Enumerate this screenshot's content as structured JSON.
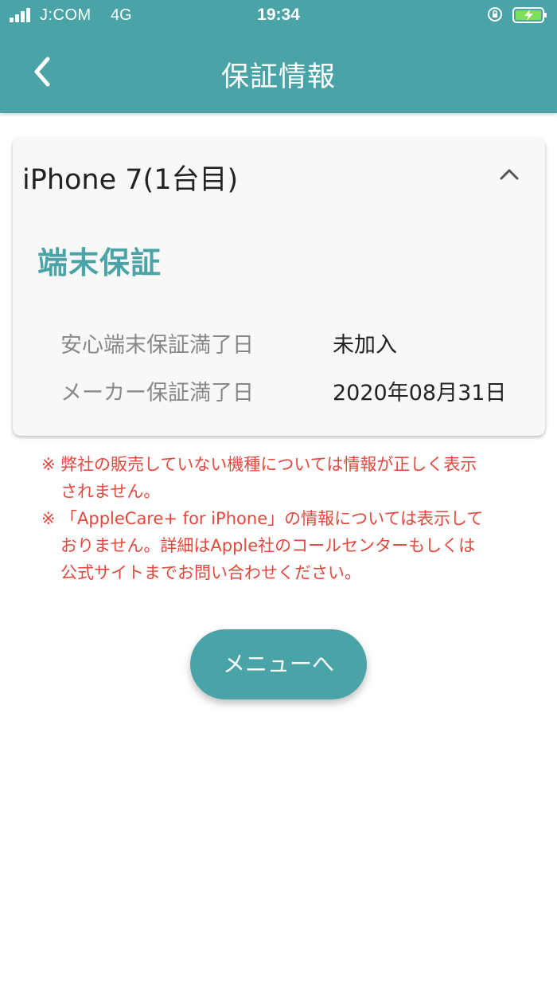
{
  "status_bar": {
    "carrier": "J:COM",
    "network": "4G",
    "time": "19:34"
  },
  "nav": {
    "title": "保証情報"
  },
  "card": {
    "device_name": "iPhone 7(1台目)",
    "section_title": "端末保証",
    "rows": [
      {
        "label": "安心端末保証満了日",
        "value": "未加入"
      },
      {
        "label": "メーカー保証満了日",
        "value": "2020年08月31日"
      }
    ]
  },
  "notes": {
    "mark": "※",
    "items": [
      {
        "line1": "弊社の販売していない機種については情報が正しく表示",
        "line2": "されません。"
      },
      {
        "line1": "「AppleCare+ for iPhone」の情報については表示して",
        "line2": "おりません。詳細はApple社のコールセンターもしくは",
        "line3": "公式サイトまでお問い合わせください。"
      }
    ]
  },
  "menu_button": {
    "label": "メニューへ"
  },
  "colors": {
    "accent": "#4aa4a7",
    "note_red": "#e4473c"
  }
}
